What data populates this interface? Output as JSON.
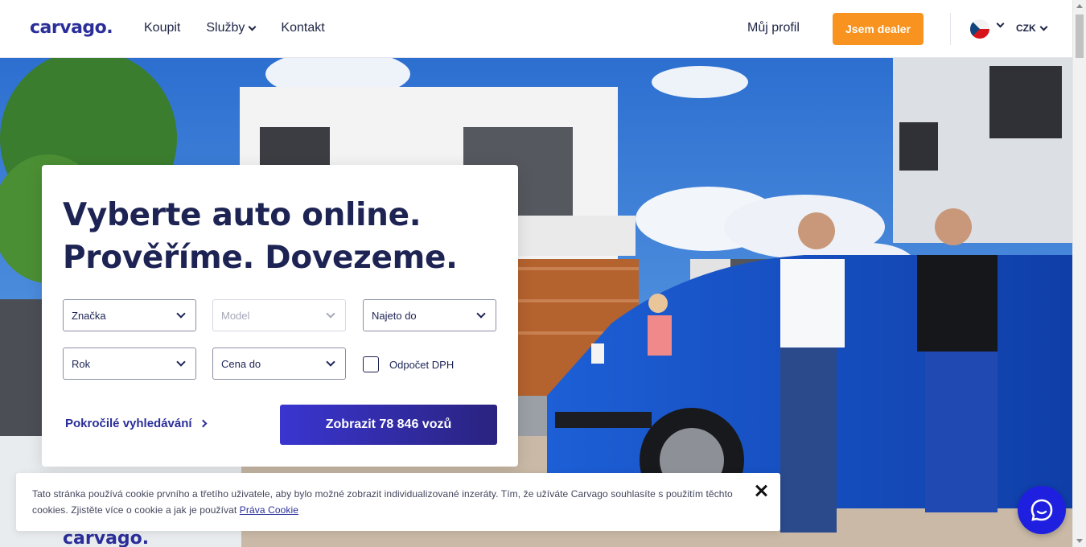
{
  "header": {
    "logo": "carvago.",
    "nav": [
      {
        "label": "Koupit",
        "has_dropdown": false
      },
      {
        "label": "Služby",
        "has_dropdown": true
      },
      {
        "label": "Kontakt",
        "has_dropdown": false
      }
    ],
    "profile_label": "Můj profil",
    "dealer_button": "Jsem dealer",
    "language_icon": "czech-flag-icon",
    "currency": "CZK"
  },
  "hero": {
    "truck_lettering": "carvago."
  },
  "search": {
    "headline_line1": "Vyberte auto online.",
    "headline_line2": "Prověříme. Dovezeme.",
    "fields": {
      "brand": "Značka",
      "model": "Model",
      "mileage": "Najeto do",
      "year": "Rok",
      "price": "Cena do"
    },
    "vat_checkbox_label": "Odpočet DPH",
    "vat_checked": false,
    "advanced_link": "Pokročilé vyhledávání",
    "submit_button": "Zobrazit 78 846 vozů"
  },
  "cookie": {
    "text": "Tato stránka používá cookie prvního a třetího uživatele, aby bylo možné zobrazit individualizované inzeráty. Tím, že užíváte Carvago souhlasíte s použitím těchto cookies. Zjistěte více o cookie a jak je používat ",
    "link": "Práva Cookie"
  },
  "colors": {
    "brand": "#2b2e99",
    "accent_orange": "#f7931e",
    "chat": "#1f1fe0"
  }
}
